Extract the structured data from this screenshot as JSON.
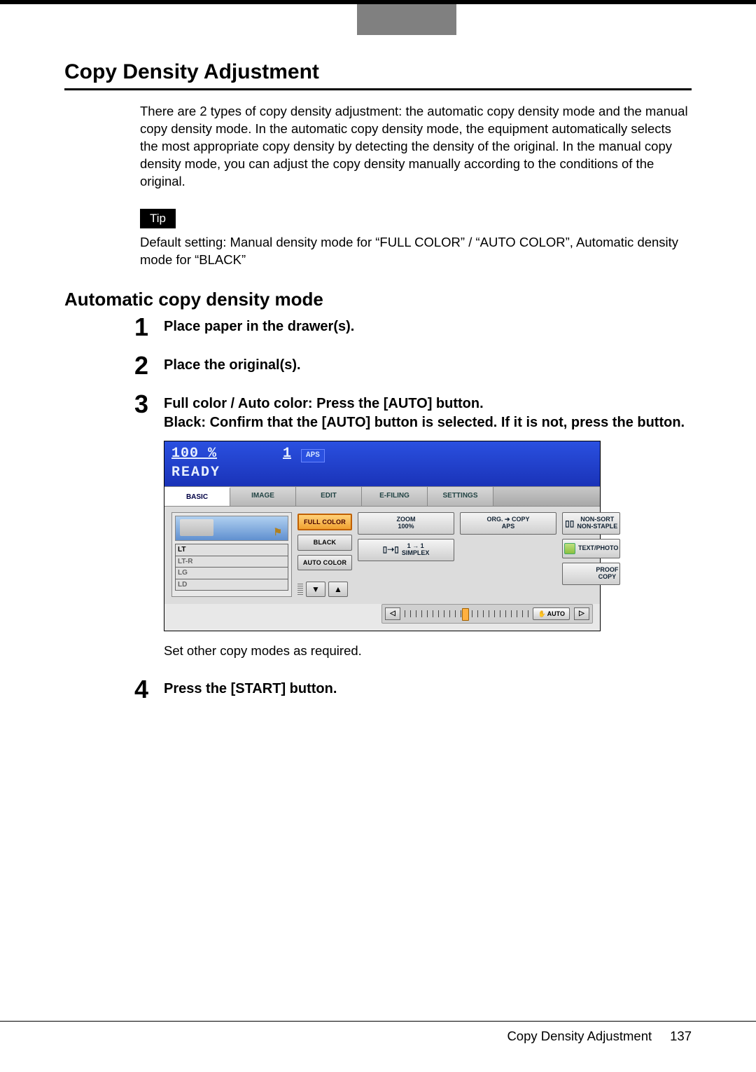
{
  "topbar": {
    "grey_present": true
  },
  "title": "Copy Density Adjustment",
  "intro": "There are 2 types of copy density adjustment: the automatic copy density mode and the manual copy density mode. In the automatic copy density mode, the equipment automatically selects the most appropriate copy density by detecting the density of the original. In the manual copy density mode, you can adjust the copy density manually according to the conditions of the original.",
  "tip_label": "Tip",
  "tip_text": "Default setting: Manual density mode for “FULL COLOR” / “AUTO COLOR”, Automatic density mode for “BLACK”",
  "subheading": "Automatic copy density mode",
  "steps": {
    "s1": "Place paper in the drawer(s).",
    "s2": "Place the original(s).",
    "s3_line1": "Full color / Auto color: Press the [AUTO] button.",
    "s3_line2": "Black: Confirm that the [AUTO] button is selected. If it is not, press the button.",
    "s3_note": "Set other copy modes as required.",
    "s4": "Press the [START] button."
  },
  "panel": {
    "zoom_pct": "100  %",
    "copy_count": "1",
    "aps_chip": "APS",
    "ready": "READY",
    "tabs": {
      "basic": "BASIC",
      "image": "IMAGE",
      "edit": "EDIT",
      "efiling": "E-FILING",
      "settings": "SETTINGS"
    },
    "trays": [
      "LT",
      "LT-R",
      "LG",
      "LD"
    ],
    "color_modes": {
      "full": "FULL COLOR",
      "black": "BLACK",
      "auto": "AUTO COLOR"
    },
    "opts": {
      "zoom": "ZOOM\n100%",
      "orig": "ORG. ➔ COPY\nAPS",
      "sort": "NON-SORT\nNON-STAPLE",
      "simplex": "1 → 1\nSIMPLEX",
      "textphoto": "TEXT/PHOTO",
      "proof": "PROOF\nCOPY",
      "auto": "AUTO"
    },
    "arrows": {
      "down": "▼",
      "up": "▲",
      "left": "◁",
      "right": "▷"
    }
  },
  "footer": {
    "title": "Copy Density Adjustment",
    "page": "137"
  }
}
